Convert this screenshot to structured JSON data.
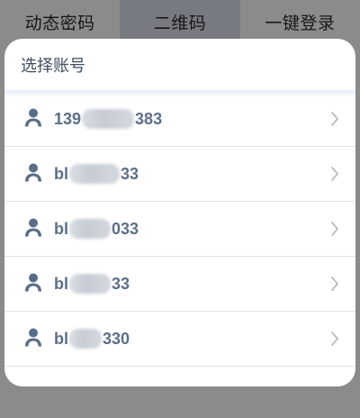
{
  "tabs": [
    {
      "label": "动态密码"
    },
    {
      "label": "二维码"
    },
    {
      "label": "一键登录"
    }
  ],
  "sheet": {
    "title": "选择账号",
    "accounts": [
      {
        "prefix": "139",
        "suffix": "383"
      },
      {
        "prefix": "bl",
        "suffix": "33"
      },
      {
        "prefix": "bl",
        "suffix": "033"
      },
      {
        "prefix": "bl",
        "suffix": "33"
      },
      {
        "prefix": "bl",
        "suffix": "330"
      }
    ]
  },
  "icons": {
    "account": "user-icon",
    "row_arrow": "chevron-right-icon"
  },
  "colors": {
    "account_text": "#5c6f8a",
    "icon": "#5a6d88",
    "chevron": "#b8bcc2"
  }
}
